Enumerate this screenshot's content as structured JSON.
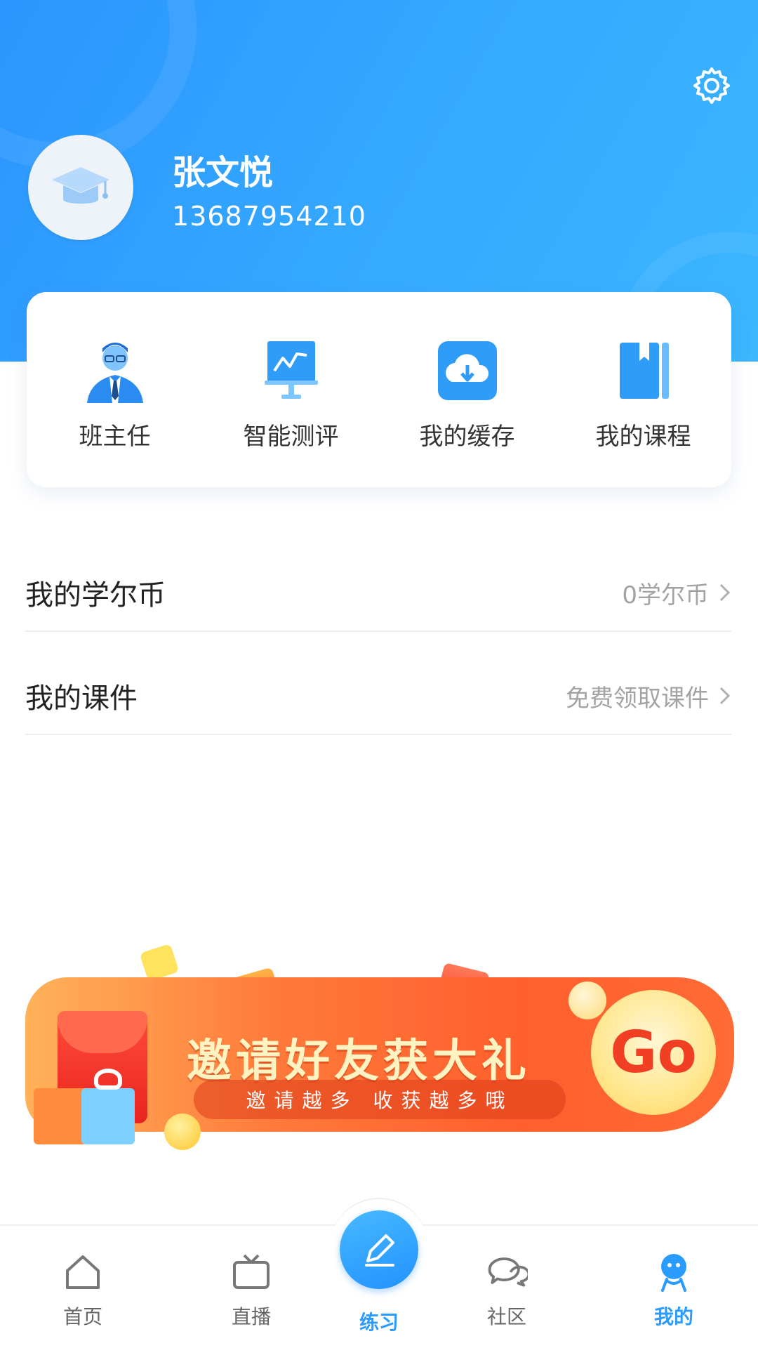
{
  "colors": {
    "primary": "#2a9bff",
    "header_start": "#2b95ff",
    "header_end": "#3cb6ff",
    "banner_orange": "#ff6b35"
  },
  "profile": {
    "name": "张文悦",
    "phone": "13687954210",
    "avatar_icon": "graduation-cap-icon",
    "settings_icon": "gear-icon"
  },
  "quick_actions": [
    {
      "label": "班主任",
      "icon": "teacher-icon"
    },
    {
      "label": "智能测评",
      "icon": "chart-board-icon"
    },
    {
      "label": "我的缓存",
      "icon": "cloud-download-icon"
    },
    {
      "label": "我的课程",
      "icon": "book-icon"
    }
  ],
  "list": {
    "coins": {
      "title": "我的学尔币",
      "value": "0学尔币"
    },
    "courseware": {
      "title": "我的课件",
      "value": "免费领取课件"
    }
  },
  "banner": {
    "title": "邀请好友获大礼",
    "subtitle": "邀请越多 收获越多哦",
    "go_label": "Go"
  },
  "nav": [
    {
      "label": "首页",
      "icon": "home-icon",
      "active": false
    },
    {
      "label": "直播",
      "icon": "tv-icon",
      "active": false
    },
    {
      "label": "练习",
      "icon": "pencil-icon",
      "active": false
    },
    {
      "label": "社区",
      "icon": "chat-bubbles-icon",
      "active": false
    },
    {
      "label": "我的",
      "icon": "person-icon",
      "active": true
    }
  ]
}
